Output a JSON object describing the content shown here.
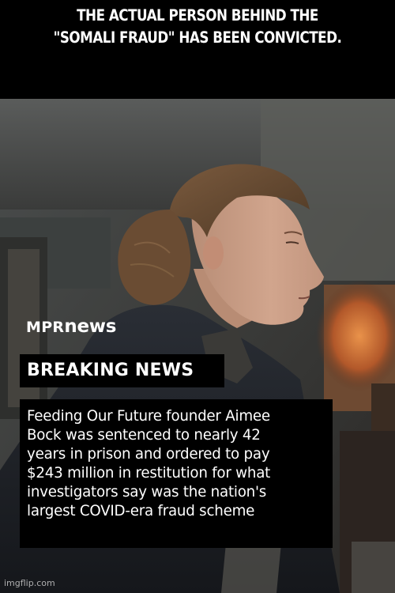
{
  "meme": {
    "headline": "THE ACTUAL PERSON BEHIND THE\n\"SOMALI FRAUD\" HAS BEEN CONVICTED."
  },
  "news_card": {
    "brand_prefix": "MPR",
    "brand_suffix": "news",
    "label": "BREAKING NEWS",
    "story_lines": [
      "Feeding Our Future founder Aimee",
      "Bock was sentenced to nearly 42",
      "years in prison and ordered to pay",
      "$243 million in restitution for what",
      "investigators say was the nation's",
      "largest COVID-era fraud scheme"
    ]
  },
  "watermark": "imgflip.com"
}
